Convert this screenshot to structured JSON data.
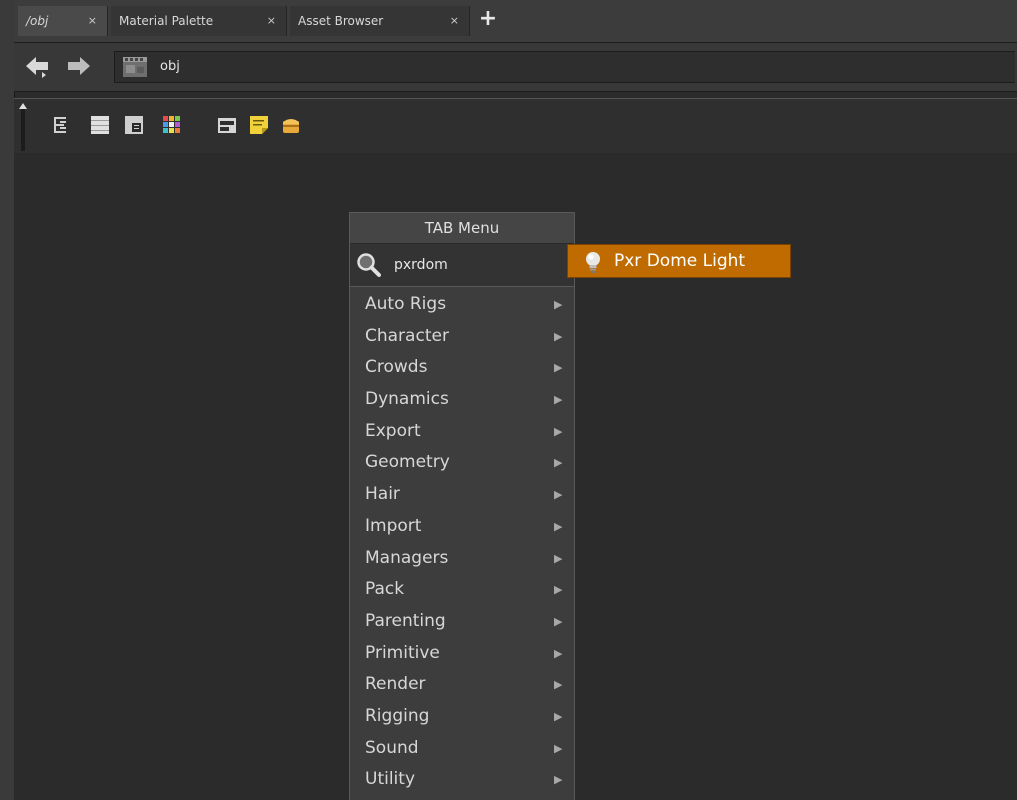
{
  "tabs": [
    {
      "label": "/obj",
      "close": "×",
      "active": true
    },
    {
      "label": "Material Palette",
      "close": "×",
      "active": false
    },
    {
      "label": "Asset Browser",
      "close": "×",
      "active": false
    }
  ],
  "tab_add_label": "+",
  "path": {
    "current": "obj"
  },
  "toolbar": {
    "icons": [
      "tree-view-icon",
      "list-view-icon",
      "thumbnail-view-icon",
      "color-palette-icon",
      "network-box-icon",
      "sticky-note-icon",
      "subnet-box-icon"
    ]
  },
  "tab_menu": {
    "title": "TAB Menu",
    "search_value": "pxrdom",
    "items": [
      {
        "label": "Auto Rigs"
      },
      {
        "label": "Character"
      },
      {
        "label": "Crowds"
      },
      {
        "label": "Dynamics"
      },
      {
        "label": "Export"
      },
      {
        "label": "Geometry"
      },
      {
        "label": "Hair"
      },
      {
        "label": "Import"
      },
      {
        "label": "Managers"
      },
      {
        "label": "Pack"
      },
      {
        "label": "Parenting"
      },
      {
        "label": "Primitive"
      },
      {
        "label": "Render"
      },
      {
        "label": "Rigging"
      },
      {
        "label": "Sound"
      },
      {
        "label": "Utility"
      }
    ],
    "submenu_arrow": "▶"
  },
  "search_result": {
    "label": "Pxr Dome Light",
    "icon": "light-bulb-icon"
  },
  "colors": {
    "background": "#2b2b2b",
    "highlight": "#c06b00",
    "menu_bg": "#3d3d3d"
  }
}
